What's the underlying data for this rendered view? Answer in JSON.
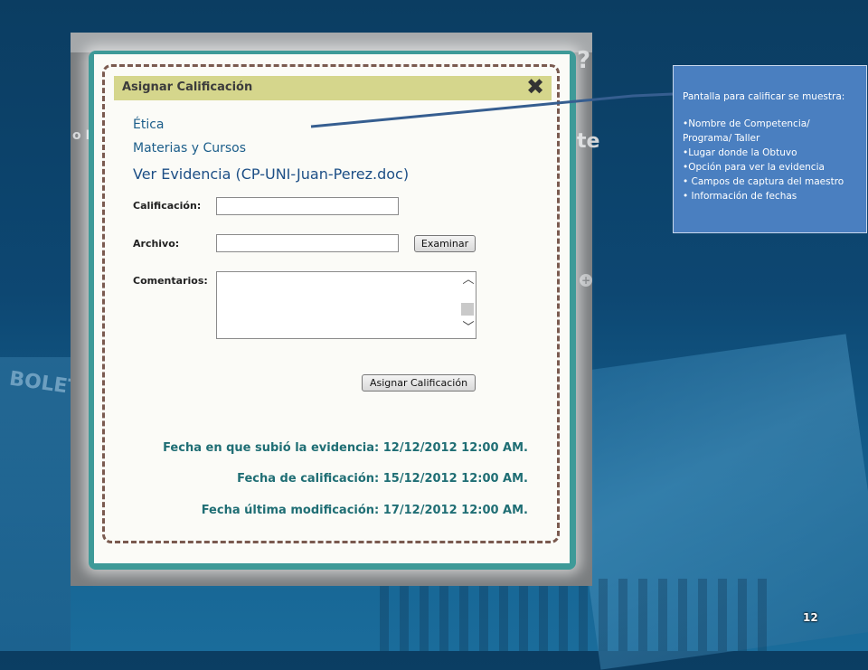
{
  "modal": {
    "title": "Asignar Calificación",
    "close_symbol": "✖"
  },
  "links": {
    "competency": "Ética",
    "courses": "Materias y Cursos",
    "evidence": "Ver Evidencia (CP-UNI-Juan-Perez.doc)"
  },
  "form": {
    "grade_label": "Calificación:",
    "grade_value": "",
    "file_label": "Archivo:",
    "file_value": "",
    "browse_button": "Examinar",
    "comments_label": "Comentarios:",
    "comments_value": "",
    "submit_button": "Asignar Calificación"
  },
  "dates": {
    "uploaded": "Fecha en que subió la evidencia: 12/12/2012 12:00 AM.",
    "graded": "Fecha de calificación: 15/12/2012 12:00 AM.",
    "modified": "Fecha última modificación: 17/12/2012 12:00 AM."
  },
  "callout": {
    "heading": "Pantalla para calificar se muestra:",
    "items": [
      "•Nombre de Competencia/ Programa/ Taller",
      "•Lugar donde la Obtuvo",
      "•Opción para ver la evidencia",
      "• Campos de captura del maestro",
      "• Información de fechas"
    ]
  },
  "slide": {
    "page_number": "12"
  },
  "colors": {
    "modal_border": "#3e9a98",
    "header_bar": "#d5d68c",
    "callout_bg": "#4a7fc0",
    "link_color": "#1c5e8a",
    "date_color": "#1f6e74"
  }
}
